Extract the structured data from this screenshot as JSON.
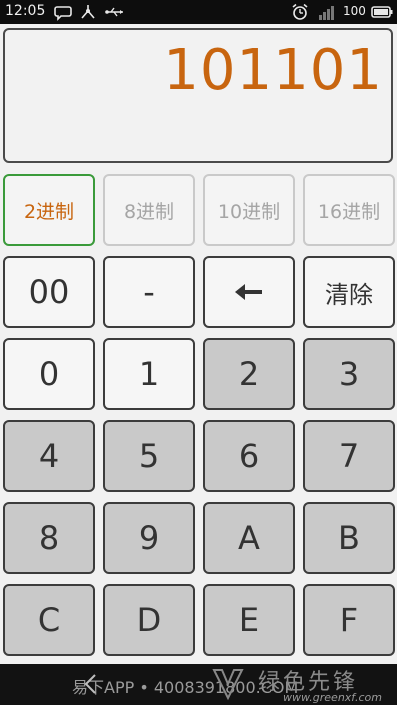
{
  "status_bar": {
    "time": "12:05",
    "battery_percent": "100",
    "icons": [
      "chat-icon",
      "usb-share-icon",
      "usb-icon",
      "alarm-icon",
      "signal-icon",
      "battery-icon"
    ]
  },
  "display": {
    "value": "101101",
    "color": "#c8650f"
  },
  "base_buttons": [
    {
      "label": "2进制",
      "active": true
    },
    {
      "label": "8进制",
      "active": false
    },
    {
      "label": "10进制",
      "active": false
    },
    {
      "label": "16进制",
      "active": false
    }
  ],
  "keys": {
    "row1": [
      "00",
      "-",
      "←",
      "清除"
    ],
    "row2": [
      "0",
      "1",
      "2",
      "3"
    ],
    "row3": [
      "4",
      "5",
      "6",
      "7"
    ],
    "row4": [
      "8",
      "9",
      "A",
      "B"
    ],
    "row5": [
      "C",
      "D",
      "E",
      "F"
    ]
  },
  "footer": {
    "text": "易下APP • 4008391800.COM",
    "brand": "绿色先锋",
    "url": "www.greenxf.com"
  },
  "colors": {
    "accent": "#c8650f",
    "active_border": "#3a9a3a",
    "disabled_key": "#c9c9c9"
  }
}
